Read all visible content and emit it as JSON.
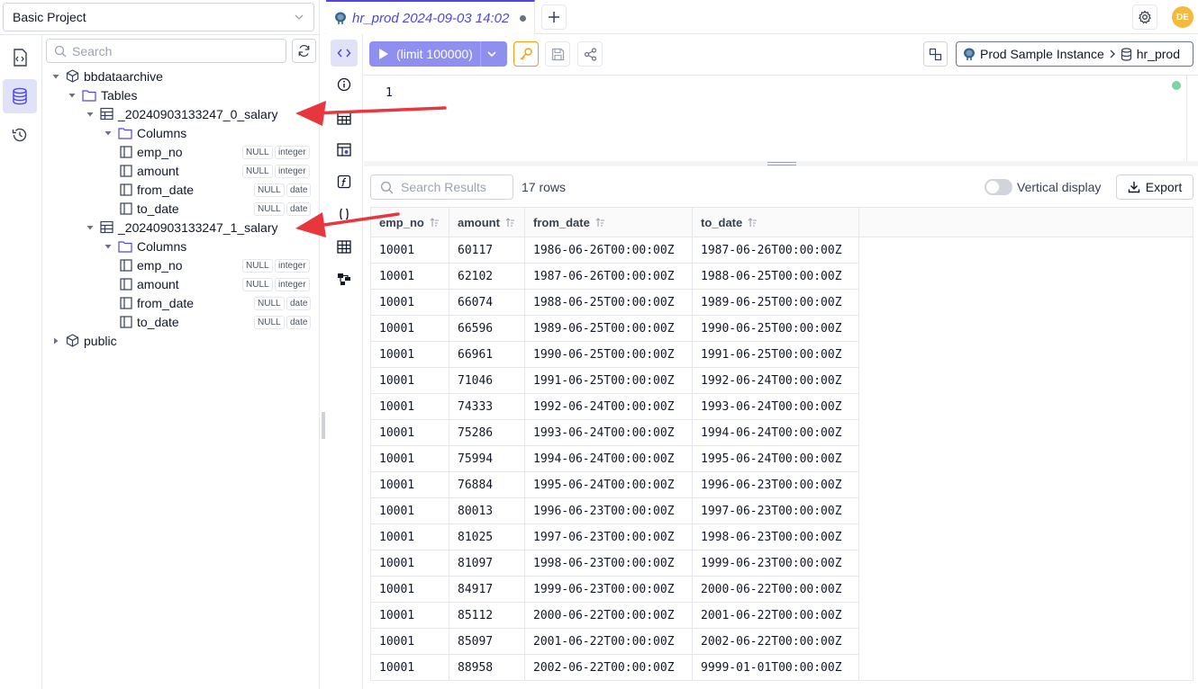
{
  "project": {
    "name": "Basic Project"
  },
  "tree": {
    "search_placeholder": "Search",
    "database": "bbdataarchive",
    "tables_label": "Tables",
    "tables": [
      {
        "name": "_20240903133247_0_salary",
        "columns_label": "Columns",
        "columns": [
          {
            "name": "emp_no",
            "nullable": "NULL",
            "type": "integer"
          },
          {
            "name": "amount",
            "nullable": "NULL",
            "type": "integer"
          },
          {
            "name": "from_date",
            "nullable": "NULL",
            "type": "date"
          },
          {
            "name": "to_date",
            "nullable": "NULL",
            "type": "date"
          }
        ]
      },
      {
        "name": "_20240903133247_1_salary",
        "columns_label": "Columns",
        "columns": [
          {
            "name": "emp_no",
            "nullable": "NULL",
            "type": "integer"
          },
          {
            "name": "amount",
            "nullable": "NULL",
            "type": "integer"
          },
          {
            "name": "from_date",
            "nullable": "NULL",
            "type": "date"
          },
          {
            "name": "to_date",
            "nullable": "NULL",
            "type": "date"
          }
        ]
      }
    ],
    "schema": "public"
  },
  "tab": {
    "title": "hr_prod 2024-09-03 14:02"
  },
  "user": {
    "initials": "DE"
  },
  "toolbar": {
    "run_label": "(limit 100000)",
    "instance": "Prod Sample Instance",
    "database": "hr_prod"
  },
  "editor": {
    "line_number": "1"
  },
  "results": {
    "search_placeholder": "Search Results",
    "rows_count": "17 rows",
    "vertical_label": "Vertical display",
    "export_label": "Export",
    "columns": [
      "emp_no",
      "amount",
      "from_date",
      "to_date"
    ],
    "rows": [
      [
        "10001",
        "60117",
        "1986-06-26T00:00:00Z",
        "1987-06-26T00:00:00Z"
      ],
      [
        "10001",
        "62102",
        "1987-06-26T00:00:00Z",
        "1988-06-25T00:00:00Z"
      ],
      [
        "10001",
        "66074",
        "1988-06-25T00:00:00Z",
        "1989-06-25T00:00:00Z"
      ],
      [
        "10001",
        "66596",
        "1989-06-25T00:00:00Z",
        "1990-06-25T00:00:00Z"
      ],
      [
        "10001",
        "66961",
        "1990-06-25T00:00:00Z",
        "1991-06-25T00:00:00Z"
      ],
      [
        "10001",
        "71046",
        "1991-06-25T00:00:00Z",
        "1992-06-24T00:00:00Z"
      ],
      [
        "10001",
        "74333",
        "1992-06-24T00:00:00Z",
        "1993-06-24T00:00:00Z"
      ],
      [
        "10001",
        "75286",
        "1993-06-24T00:00:00Z",
        "1994-06-24T00:00:00Z"
      ],
      [
        "10001",
        "75994",
        "1994-06-24T00:00:00Z",
        "1995-06-24T00:00:00Z"
      ],
      [
        "10001",
        "76884",
        "1995-06-24T00:00:00Z",
        "1996-06-23T00:00:00Z"
      ],
      [
        "10001",
        "80013",
        "1996-06-23T00:00:00Z",
        "1997-06-23T00:00:00Z"
      ],
      [
        "10001",
        "81025",
        "1997-06-23T00:00:00Z",
        "1998-06-23T00:00:00Z"
      ],
      [
        "10001",
        "81097",
        "1998-06-23T00:00:00Z",
        "1999-06-23T00:00:00Z"
      ],
      [
        "10001",
        "84917",
        "1999-06-23T00:00:00Z",
        "2000-06-22T00:00:00Z"
      ],
      [
        "10001",
        "85112",
        "2000-06-22T00:00:00Z",
        "2001-06-22T00:00:00Z"
      ],
      [
        "10001",
        "85097",
        "2001-06-22T00:00:00Z",
        "2002-06-22T00:00:00Z"
      ],
      [
        "10001",
        "88958",
        "2002-06-22T00:00:00Z",
        "9999-01-01T00:00:00Z"
      ]
    ]
  },
  "colors": {
    "accent": "#4f46e5",
    "run_button": "#8f8ff0",
    "annotation_arrow": "#e8363d",
    "avatar": "#f5b93b"
  },
  "icons": {
    "activity": [
      "worksheet-icon",
      "database-icon",
      "history-icon"
    ],
    "editor_side": [
      "code-icon",
      "info-icon",
      "table-icon",
      "view-icon",
      "function-icon",
      "procedure-icon",
      "grid-icon",
      "diagram-icon"
    ]
  }
}
